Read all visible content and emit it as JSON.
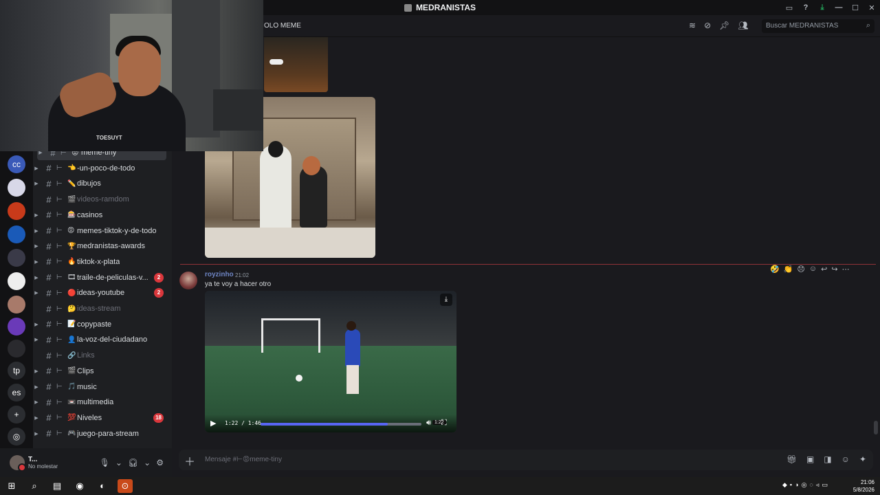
{
  "window": {
    "title": "MEDRANISTAS",
    "controls": [
      "inbox-icon",
      "help-icon",
      "download-icon",
      "minimize-icon",
      "maximize-icon",
      "close-icon"
    ]
  },
  "header": {
    "channel_label": "OLO MEME",
    "search_placeholder": "Buscar MEDRANISTAS"
  },
  "servers": [
    {
      "initials": "",
      "badge": "19",
      "color": "#c03030"
    },
    {
      "initials": "cc",
      "badge": "12",
      "color": "#3a5ab8"
    },
    {
      "initials": "",
      "badge": "6",
      "color": "#d8d8e8"
    },
    {
      "initials": "",
      "badge": "96",
      "color": "#c83a1a"
    },
    {
      "initials": "",
      "badge": "139",
      "color": "#1a5ab8"
    },
    {
      "initials": "",
      "badge": "481",
      "color": "#3a3a48"
    },
    {
      "initials": "",
      "badge": "388",
      "color": "#eeeeee"
    },
    {
      "initials": "",
      "badge": "418",
      "color": "#a87a6a"
    },
    {
      "initials": "",
      "badge": "55",
      "color": "#6a3ab8"
    },
    {
      "initials": "",
      "badge": "42",
      "color": "#2a2a2e"
    },
    {
      "initials": "tp",
      "badge": "",
      "color": "#2b2d31"
    },
    {
      "initials": "es",
      "badge": "",
      "color": "#2b2d31"
    },
    {
      "initials": "+",
      "badge": "",
      "color": "#2b2d31"
    },
    {
      "initials": "◎",
      "badge": "",
      "color": "#2b2d31"
    }
  ],
  "channels": [
    {
      "emoji": "😡",
      "name": "meme-tiny",
      "badge": "",
      "muted": false,
      "active": true
    },
    {
      "emoji": "👈",
      "name": "-un-poco-de-todo",
      "badge": "",
      "muted": false
    },
    {
      "emoji": "✏️",
      "name": "dibujos",
      "badge": "",
      "muted": false
    },
    {
      "emoji": "🎬",
      "name": "videos-ramdom",
      "badge": "",
      "muted": true
    },
    {
      "emoji": "🎰",
      "name": "casinos",
      "badge": "",
      "muted": false
    },
    {
      "emoji": "😡",
      "name": "memes-tiktok-y-de-todo",
      "badge": "",
      "muted": false
    },
    {
      "emoji": "🏆",
      "name": "medranistas-awards",
      "badge": "",
      "muted": false
    },
    {
      "emoji": "🔥",
      "name": "tiktok-x-plata",
      "badge": "",
      "muted": false
    },
    {
      "emoji": "🎞",
      "name": "traile-de-peliculas-v...",
      "badge": "2",
      "muted": false
    },
    {
      "emoji": "🔴",
      "name": "ideas-youtube",
      "badge": "2",
      "muted": false
    },
    {
      "emoji": "🤔",
      "name": "ideas-stream",
      "badge": "",
      "muted": true
    },
    {
      "emoji": "📝",
      "name": "copypaste",
      "badge": "",
      "muted": false
    },
    {
      "emoji": "👤",
      "name": "la-voz-del-ciudadano",
      "badge": "",
      "muted": false
    },
    {
      "emoji": "🔗",
      "name": "Links",
      "badge": "",
      "muted": true
    },
    {
      "emoji": "🎬",
      "name": "Clips",
      "badge": "",
      "muted": false
    },
    {
      "emoji": "🎵",
      "name": "music",
      "badge": "",
      "muted": false
    },
    {
      "emoji": "📼",
      "name": "multimedia",
      "badge": "",
      "muted": false
    },
    {
      "emoji": "💯",
      "name": "Niveles",
      "badge": "18",
      "muted": false
    },
    {
      "emoji": "🎮",
      "name": "juego-para-stream",
      "badge": "",
      "muted": false
    }
  ],
  "user": {
    "name": "T...",
    "status": "No molestar"
  },
  "message": {
    "author": "royzinho",
    "time": "21:02",
    "text": "ya te voy a hacer otro"
  },
  "video": {
    "current": "1:22",
    "duration": "1:46",
    "time_display": "1:22 / 1:46",
    "progress": 0.79,
    "tooltip": "1:22"
  },
  "composer": {
    "placeholder": "Mensaje #⊢😡meme-tiny"
  },
  "webcam": {
    "shirt_text": "TOESUYT"
  },
  "taskbar": {
    "time": "21:06",
    "date": "5/8/2026"
  }
}
